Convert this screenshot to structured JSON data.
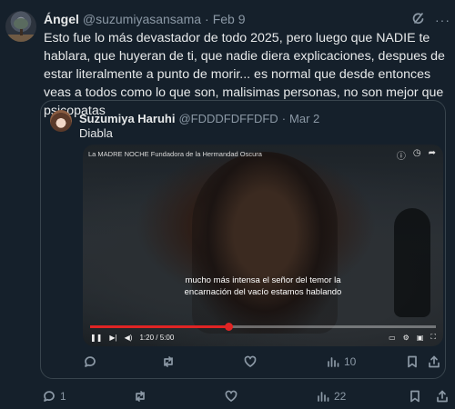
{
  "tweet": {
    "author_name": "Ángel",
    "author_handle": "@suzumiyasansama",
    "separator": "·",
    "date": "Feb 9",
    "text": "Esto fue lo más devastador de todo 2025, pero luego que NADIE te hablara, que huyeran de ti, que nadie diera explicaciones, despues de estar literalmente a punto de morir... es normal que desde entonces veas a todos como lo que son, malisimas personas, no son mejor que psicopatas",
    "icons": {
      "grok": "grok-icon",
      "more": "more-icon"
    },
    "actions": {
      "replies": "1",
      "reposts": "",
      "likes": "",
      "views": "22"
    }
  },
  "quote": {
    "author_name": "Suzumiya Haruhi",
    "author_handle": "@FDDDFDFFDFD",
    "separator": "·",
    "date": "Mar 2",
    "text": "Diabla",
    "video": {
      "title": "La MADRE NOCHE Fundadora de la Hermandad Oscura",
      "subtitle_line1": "mucho más intensa el señor del temor la",
      "subtitle_line2": "encarnación del vacío estamos hablando",
      "time": "1:20 / 5:00",
      "progress": 0.4
    },
    "actions": {
      "replies": "",
      "reposts": "",
      "likes": "",
      "views": "10"
    }
  },
  "colors": {
    "background": "#15202b",
    "text": "#e7e9ea",
    "muted": "#8b98a5",
    "border": "#38444d",
    "progress": "#e02424"
  }
}
